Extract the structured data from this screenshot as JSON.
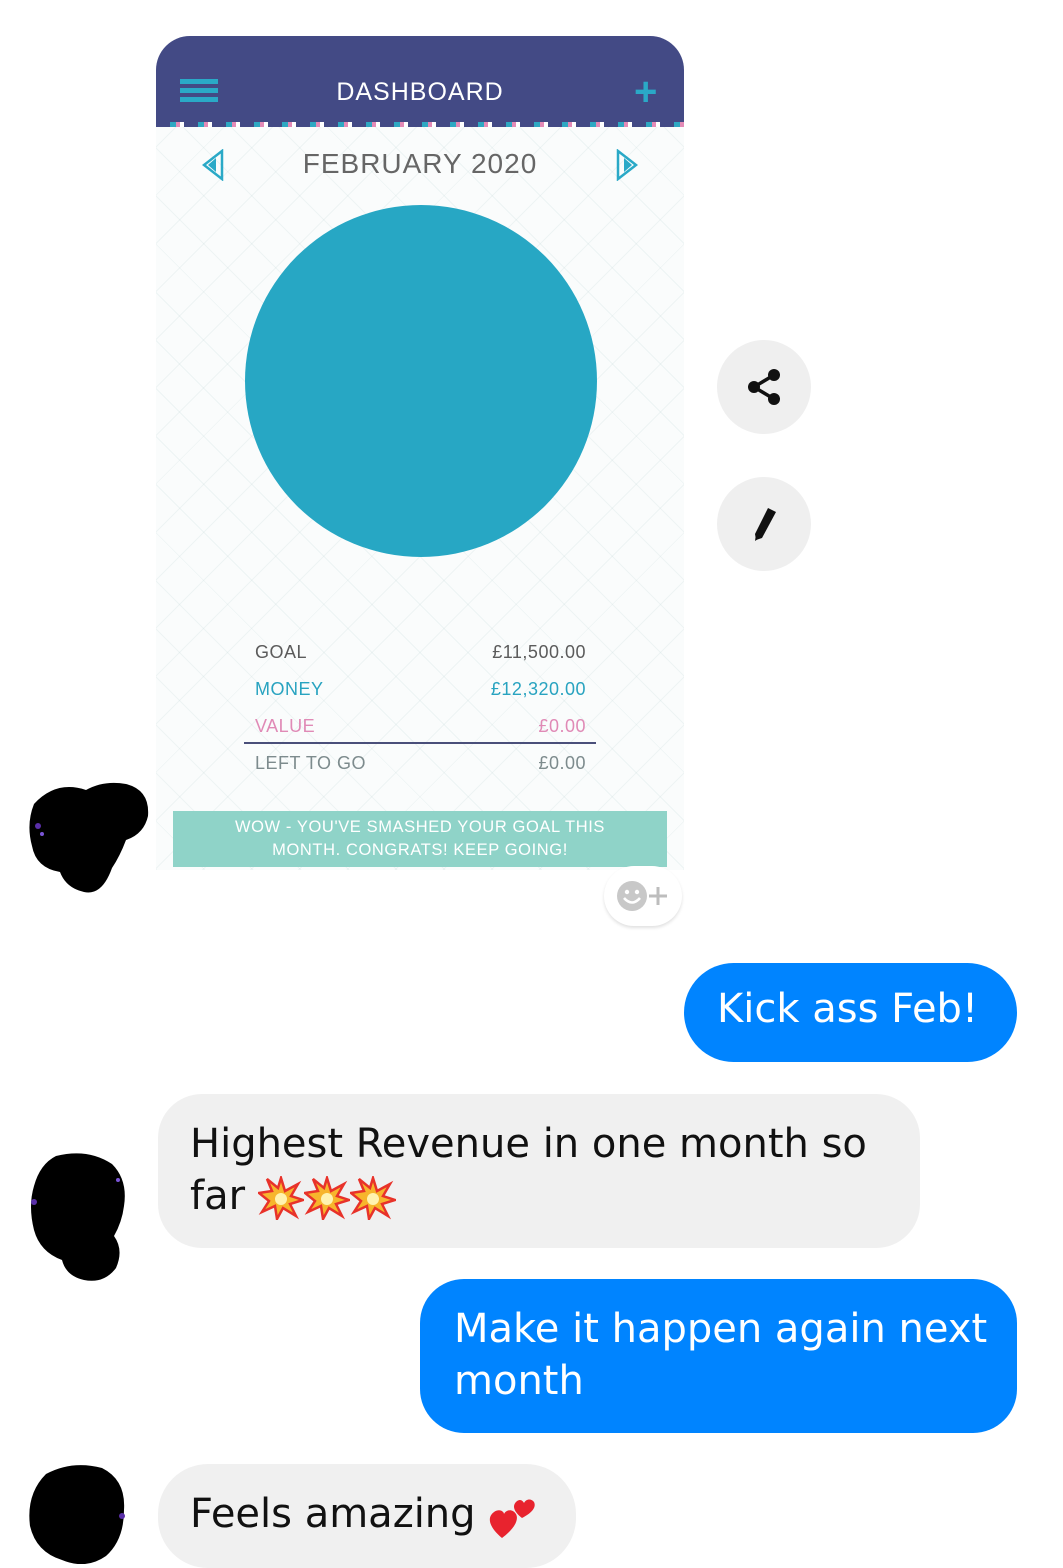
{
  "shared_screenshot": {
    "header": {
      "title": "DASHBOARD",
      "menu_icon": "hamburger-menu-icon",
      "add_icon": "plus-icon"
    },
    "month": {
      "label": "FEBRUARY 2020",
      "prev_icon": "triangle-left-icon",
      "next_icon": "triangle-right-icon"
    },
    "goal_progress_fraction": 1.0,
    "stats": [
      {
        "label": "GOAL",
        "value": "£11,500.00"
      },
      {
        "label": "MONEY",
        "value": "£12,320.00"
      },
      {
        "label": "VALUE",
        "value": "£0.00"
      },
      {
        "label": "LEFT TO GO",
        "value": "£0.00"
      }
    ],
    "banner_line1": "WOW - YOU'VE SMASHED YOUR GOAL THIS",
    "banner_line2": "MONTH. CONGRATS! KEEP GOING!"
  },
  "image_actions": {
    "share_icon": "share-icon",
    "edit_icon": "pencil-icon"
  },
  "reaction": {
    "icon": "add-reaction-icon"
  },
  "messages": [
    {
      "from": "me",
      "text": "Kick ass Feb!"
    },
    {
      "from": "them",
      "text_line1": "Highest Revenue in one month so",
      "text_line2": "far",
      "emojis": [
        "collision-emoji",
        "collision-emoji",
        "collision-emoji"
      ]
    },
    {
      "from": "me",
      "text_line1": "Make it happen again next",
      "text_line2": "month"
    },
    {
      "from": "them",
      "text": "Feels amazing",
      "emoji": "two-hearts-emoji"
    }
  ],
  "colors": {
    "header": "#434a85",
    "accent_teal": "#27a7c4",
    "banner": "#8fd3c8",
    "outgoing_bubble": "#0084ff",
    "incoming_bubble": "#f0f0f0"
  }
}
